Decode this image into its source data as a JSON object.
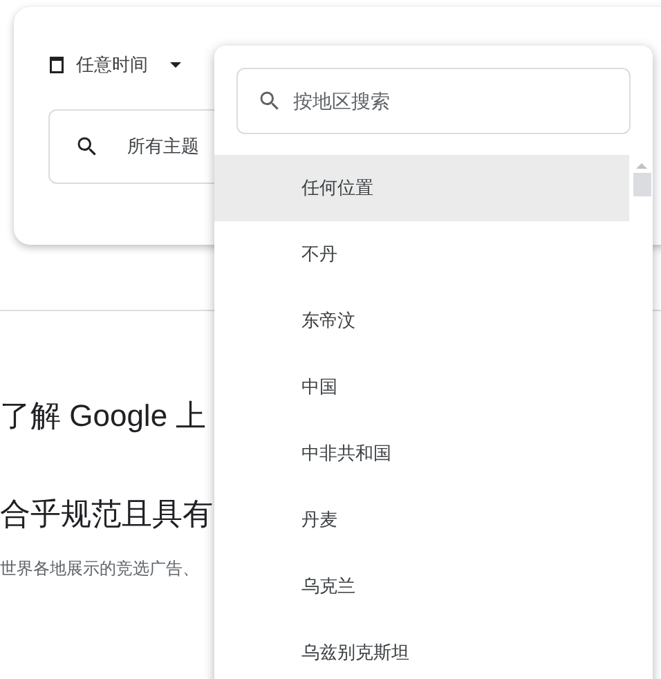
{
  "filters": {
    "date_button": "任意时间",
    "topic_field": {
      "placeholder": "所有主题"
    }
  },
  "content": {
    "heading": "了解 Google 上",
    "subheading": "合乎规范且具有",
    "body": "世界各地展示的竞选广告、"
  },
  "region_dropdown": {
    "search": {
      "placeholder": "按地区搜索"
    },
    "items": [
      {
        "label": "任何位置",
        "selected": true
      },
      {
        "label": "不丹",
        "selected": false
      },
      {
        "label": "东帝汶",
        "selected": false
      },
      {
        "label": "中国",
        "selected": false
      },
      {
        "label": "中非共和国",
        "selected": false
      },
      {
        "label": "丹麦",
        "selected": false
      },
      {
        "label": "乌克兰",
        "selected": false
      },
      {
        "label": "乌兹别克斯坦",
        "selected": false
      }
    ]
  }
}
